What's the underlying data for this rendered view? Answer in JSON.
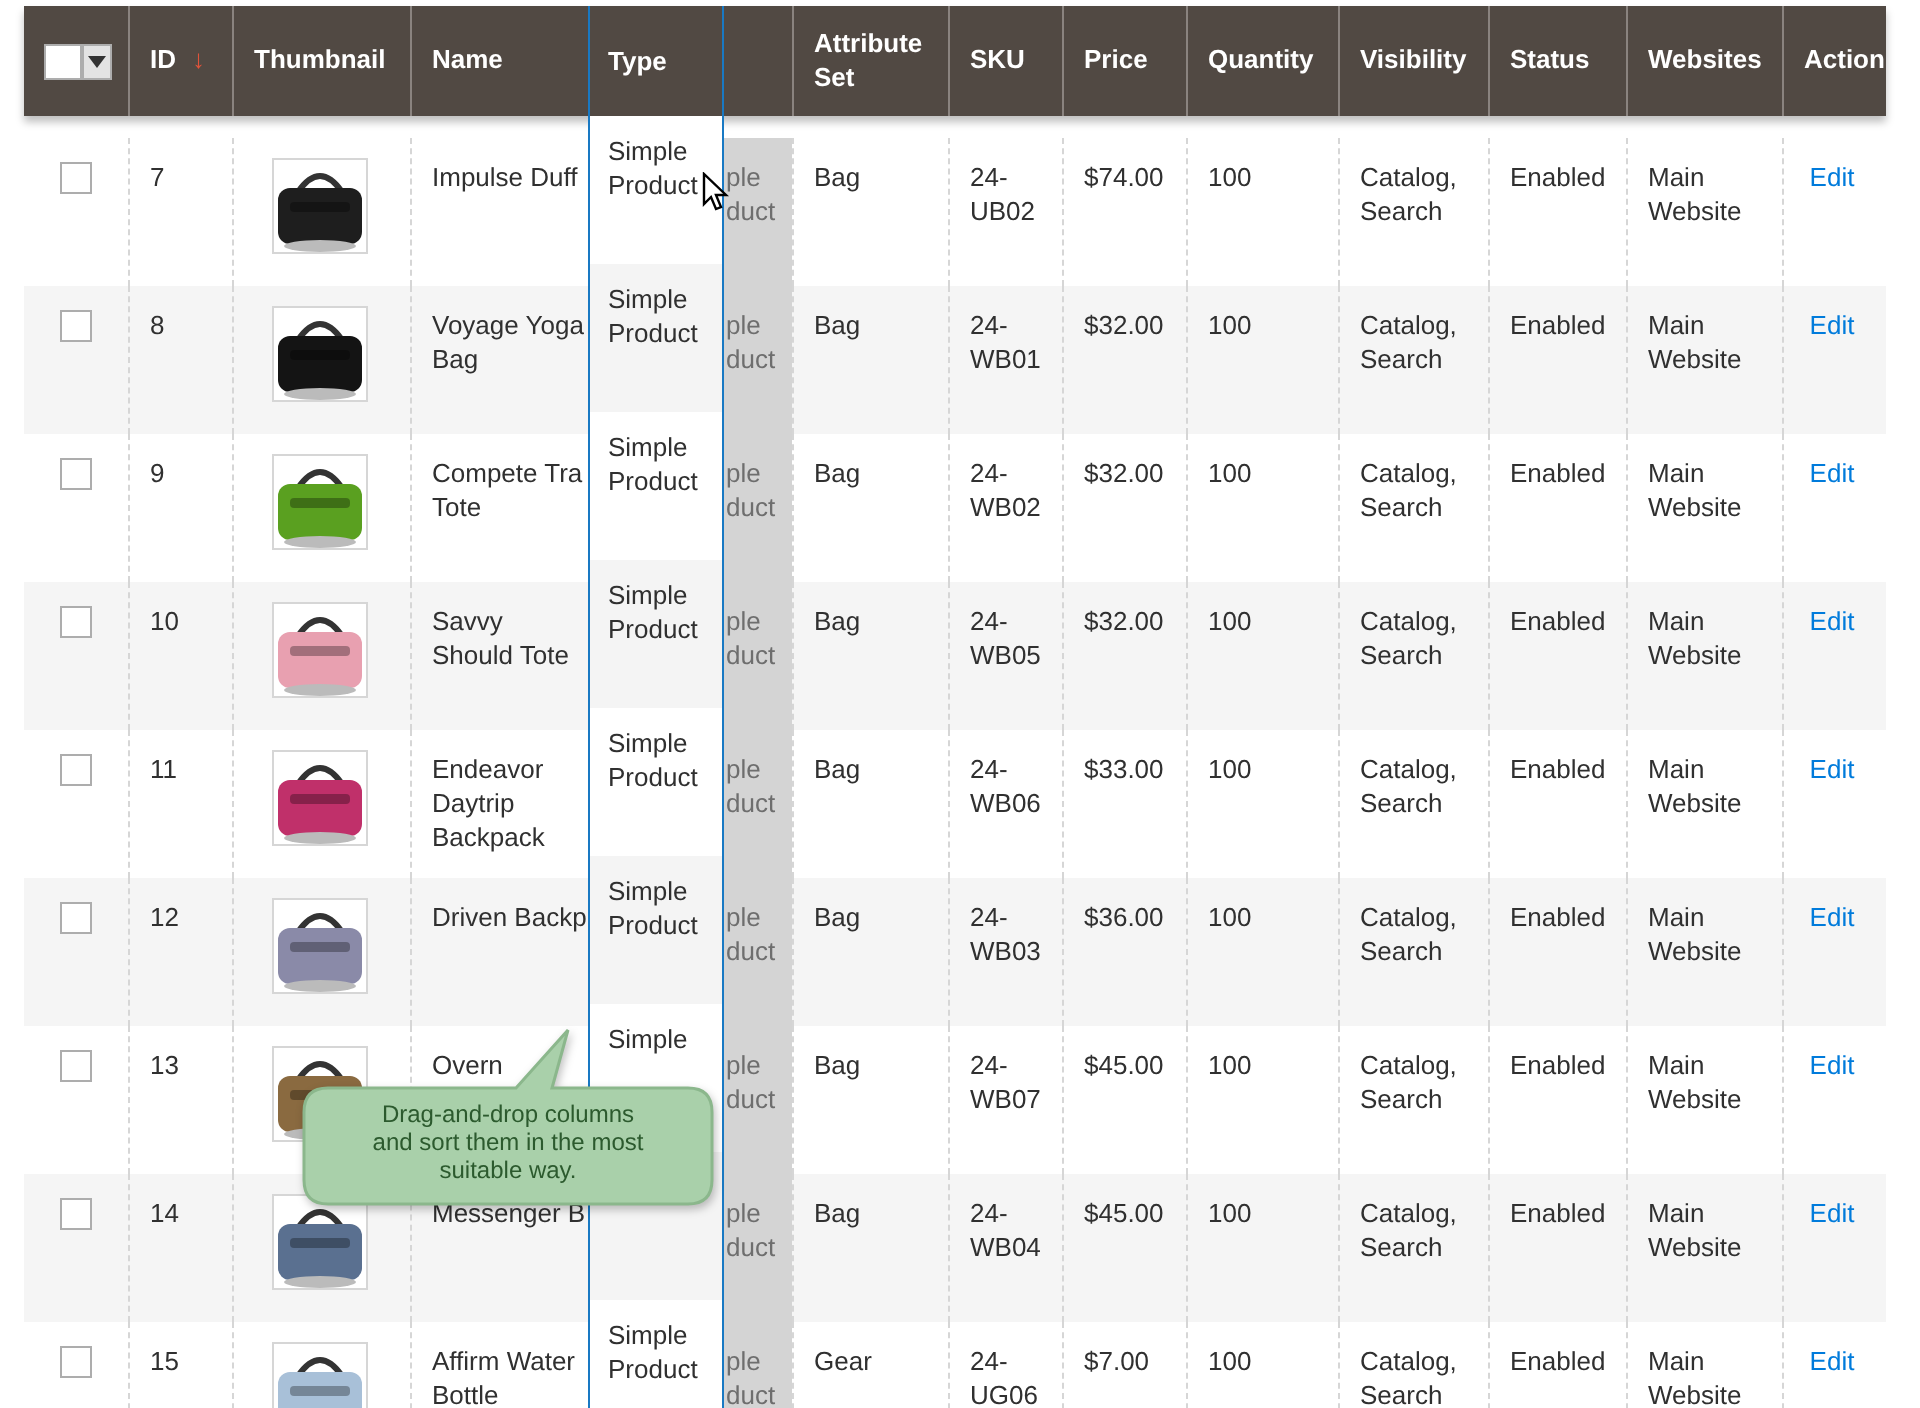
{
  "header_select": {
    "checked": false
  },
  "columns": [
    {
      "label": "ID",
      "sort_arrow": "↓"
    },
    {
      "label": "Thumbnail"
    },
    {
      "label": "Name"
    },
    {
      "label": "Attribute Set"
    },
    {
      "label": "SKU"
    },
    {
      "label": "Price"
    },
    {
      "label": "Quantity"
    },
    {
      "label": "Visibility"
    },
    {
      "label": "Status"
    },
    {
      "label": "Websites"
    },
    {
      "label": "Action"
    }
  ],
  "dragged_column": {
    "label": "Type"
  },
  "rows": [
    {
      "checked": false,
      "id": "7",
      "name": "Impulse Duff",
      "type": "Simple Product",
      "type_behind": "ple duct",
      "attribute_set": "Bag",
      "sku": "24-UB02",
      "price": "$74.00",
      "quantity": "100",
      "visibility": "Catalog, Search",
      "status": "Enabled",
      "websites": "Main Website",
      "action": "Edit"
    },
    {
      "checked": false,
      "id": "8",
      "name": "Voyage Yoga Bag",
      "type": "Simple Product",
      "type_behind": "ple duct",
      "attribute_set": "Bag",
      "sku": "24-WB01",
      "price": "$32.00",
      "quantity": "100",
      "visibility": "Catalog, Search",
      "status": "Enabled",
      "websites": "Main Website",
      "action": "Edit"
    },
    {
      "checked": false,
      "id": "9",
      "name": "Compete Tra Tote",
      "type": "Simple Product",
      "type_behind": "ple duct",
      "attribute_set": "Bag",
      "sku": "24-WB02",
      "price": "$32.00",
      "quantity": "100",
      "visibility": "Catalog, Search",
      "status": "Enabled",
      "websites": "Main Website",
      "action": "Edit"
    },
    {
      "checked": false,
      "id": "10",
      "name": "Savvy Should Tote",
      "type": "Simple Product",
      "type_behind": "ple duct",
      "attribute_set": "Bag",
      "sku": "24-WB05",
      "price": "$32.00",
      "quantity": "100",
      "visibility": "Catalog, Search",
      "status": "Enabled",
      "websites": "Main Website",
      "action": "Edit"
    },
    {
      "checked": false,
      "id": "11",
      "name": "Endeavor Daytrip Backpack",
      "type": "Simple Product",
      "type_behind": "ple duct",
      "attribute_set": "Bag",
      "sku": "24-WB06",
      "price": "$33.00",
      "quantity": "100",
      "visibility": "Catalog, Search",
      "status": "Enabled",
      "websites": "Main Website",
      "action": "Edit"
    },
    {
      "checked": false,
      "id": "12",
      "name": "Driven Backp",
      "type": "Simple Product",
      "type_behind": "ple duct",
      "attribute_set": "Bag",
      "sku": "24-WB03",
      "price": "$36.00",
      "quantity": "100",
      "visibility": "Catalog, Search",
      "status": "Enabled",
      "websites": "Main Website",
      "action": "Edit"
    },
    {
      "checked": false,
      "id": "13",
      "name": "Overn",
      "type": "Simple",
      "type_behind": "ple duct",
      "attribute_set": "Bag",
      "sku": "24-WB07",
      "price": "$45.00",
      "quantity": "100",
      "visibility": "Catalog, Search",
      "status": "Enabled",
      "websites": "Main Website",
      "action": "Edit"
    },
    {
      "checked": false,
      "id": "14",
      "name": "Messenger B",
      "type_behind": "ple duct",
      "attribute_set": "Bag",
      "sku": "24-WB04",
      "price": "$45.00",
      "quantity": "100",
      "visibility": "Catalog, Search",
      "status": "Enabled",
      "websites": "Main Website",
      "action": "Edit"
    },
    {
      "checked": false,
      "id": "15",
      "name": "Affirm Water Bottle",
      "type": "Simple Product",
      "type_behind": "ple duct",
      "attribute_set": "Gear",
      "sku": "24-UG06",
      "price": "$7.00",
      "quantity": "100",
      "visibility": "Catalog, Search",
      "status": "Enabled",
      "websites": "Main Website",
      "action": "Edit"
    }
  ],
  "tooltip": {
    "text": "Drag-and-drop columns and sort them in the most suitable way."
  }
}
